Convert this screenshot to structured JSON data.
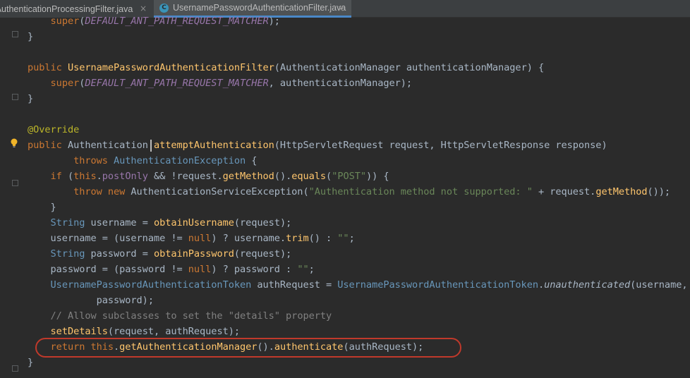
{
  "tabs": [
    {
      "label": "ctAuthenticationProcessingFilter.java",
      "active": false,
      "close": "×"
    },
    {
      "label": "UsernamePasswordAuthenticationFilter.java",
      "active": true,
      "close": "×",
      "icon": "C"
    }
  ],
  "code_lines": [
    "    super(DEFAULT_ANT_PATH_REQUEST_MATCHER);",
    "}",
    "",
    "public UsernamePasswordAuthenticationFilter(AuthenticationManager authenticationManager) {",
    "    super(DEFAULT_ANT_PATH_REQUEST_MATCHER, authenticationManager);",
    "}",
    "",
    "@Override",
    "public Authentication attemptAuthentication(HttpServletRequest request, HttpServletResponse response)",
    "        throws AuthenticationException {",
    "    if (this.postOnly && !request.getMethod().equals(\"POST\")) {",
    "        throw new AuthenticationServiceException(\"Authentication method not supported: \" + request.getMethod());",
    "    }",
    "    String username = obtainUsername(request);",
    "    username = (username != null) ? username.trim() : \"\";",
    "    String password = obtainPassword(request);",
    "    password = (password != null) ? password : \"\";",
    "    UsernamePasswordAuthenticationToken authRequest = UsernamePasswordAuthenticationToken.unauthenticated(username,",
    "            password);",
    "    // Allow subclasses to set the \"details\" property",
    "    setDetails(request, authRequest);",
    "    return this.getAuthenticationManager().authenticate(authRequest);",
    "}"
  ],
  "annotation": {
    "highlighted_line_index": 21,
    "color": "#c0392b"
  },
  "colors": {
    "background": "#2b2b2b",
    "keyword": "#cc7832",
    "method": "#ffc66d",
    "static_field": "#9876aa",
    "string": "#6a8759",
    "comment": "#808080",
    "annotation": "#bbb529",
    "type": "#6897bb"
  }
}
